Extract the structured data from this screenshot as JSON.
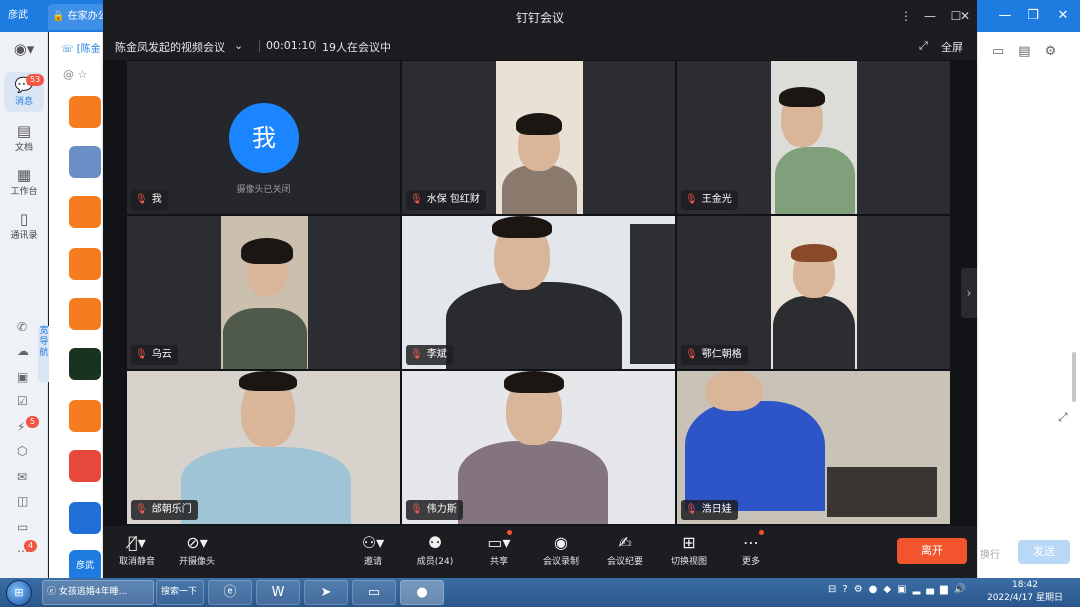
{
  "app": {
    "brand": "彦武",
    "tab_label": "在家办公",
    "nav": [
      {
        "label": "消息",
        "badge": "53"
      },
      {
        "label": "文档"
      },
      {
        "label": "工作台"
      },
      {
        "label": "通讯录"
      }
    ],
    "guide_label": "宽导航",
    "side_badges": [
      "5",
      "4"
    ],
    "conv_header": "[陈金",
    "conv_bottom_label": "彦武",
    "right": {
      "wrap_label": "换行",
      "send_label": "发送"
    }
  },
  "meeting": {
    "window_title": "钉钉会议",
    "meeting_name": "陈金凤发起的视频会议",
    "elapsed": "00:01:10",
    "participant_status": "19人在会议中",
    "fullscreen_label": "全屏",
    "self_avatar_text": "我",
    "camera_off_text": "摄像头已关闭",
    "participants": [
      {
        "name": "我"
      },
      {
        "name": "水保 包红财"
      },
      {
        "name": "王金光"
      },
      {
        "name": "乌云"
      },
      {
        "name": "李斌"
      },
      {
        "name": "鄂仁朝格"
      },
      {
        "name": "邰朝乐门"
      },
      {
        "name": "伟力斯"
      },
      {
        "name": "浩日娃"
      }
    ],
    "toolbar": {
      "mute": "取消静音",
      "camera": "开摄像头",
      "invite": "邀请",
      "members": "成员(24)",
      "share": "共享",
      "record": "会议录制",
      "minutes": "会议纪要",
      "switch_view": "切换视图",
      "more": "更多",
      "leave": "离开"
    }
  },
  "taskbar": {
    "item1": "女孩逃婚4年睡...",
    "item2": "搜索一下",
    "time": "18:42",
    "date": "2022/4/17 星期日"
  }
}
